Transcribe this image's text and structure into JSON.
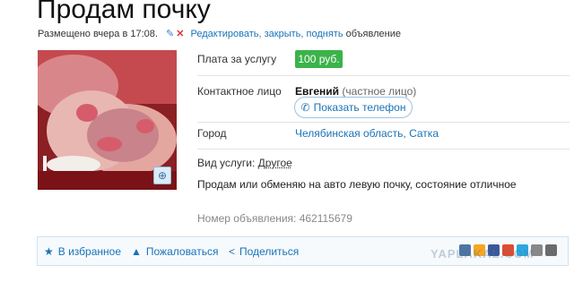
{
  "title": "Продам почку",
  "posted": {
    "text": "Размещено вчера в 17:08.",
    "edit_links": "Редактировать, закрыть, поднять",
    "suffix": "объявление"
  },
  "details": {
    "fee_label": "Плата за услугу",
    "fee_value": "100 руб.",
    "contact_label": "Контактное лицо",
    "contact_name": "Евгений",
    "contact_type": "(частное лицо)",
    "phone_button": "Показать телефон",
    "city_label": "Город",
    "city_value": "Челябинская область, Сатка",
    "service_label": "Вид услуги:",
    "service_value": "Другое",
    "description": "Продам или обменяю на авто левую почку, состояние отличное",
    "ad_number": "Номер объявления: 462115679"
  },
  "actions": {
    "favorite": "В избранное",
    "complain": "Пожаловаться",
    "share": "Поделиться"
  },
  "watermark": "YAPLAKAL.COM",
  "colors": {
    "link": "#1a73b8",
    "price_badge": "#3bb34a",
    "social": [
      "#4c75a3",
      "#f5a623",
      "#3b5998",
      "#e04b2f",
      "#2aa9e0",
      "#888888",
      "#6b6b6b"
    ]
  }
}
